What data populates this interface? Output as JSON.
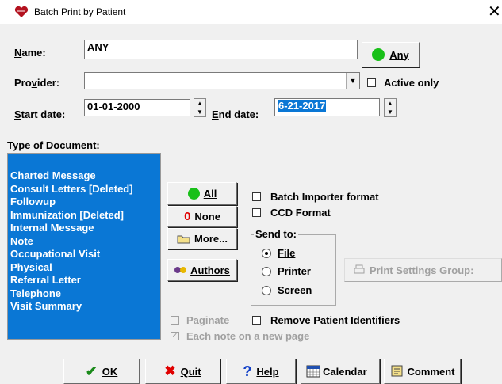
{
  "window": {
    "title": "Batch Print by Patient",
    "close_glyph": "✕"
  },
  "name_row": {
    "label": "Name:",
    "value": "ANY",
    "any_button": "Any"
  },
  "provider_row": {
    "label": "Provider:",
    "value": "",
    "active_only": "Active only",
    "active_only_checked": false
  },
  "dates": {
    "start_label": "Start date:",
    "start_value": "01-01-2000",
    "end_label": "End date:",
    "end_value": "6-21-2017"
  },
  "documents": {
    "label": "Type of Document:",
    "items": [
      "Charted Message",
      "Consult Letters [Deleted]",
      "Followup",
      "Immunization [Deleted]",
      "Internal Message",
      "Note",
      "Occupational Visit",
      "Physical",
      "Referral Letter",
      "Telephone",
      "Visit Summary"
    ],
    "selection_color": "#0a77d5"
  },
  "buttons": {
    "all": "All",
    "none": "None",
    "more": "More...",
    "authors": "Authors",
    "print_settings": "Print Settings Group:"
  },
  "options": {
    "batch_importer": "Batch Importer format",
    "ccd": "CCD Format",
    "paginate": "Paginate",
    "remove_ids": "Remove Patient Identifiers",
    "each_note": "Each note on a new page"
  },
  "send_to": {
    "legend": "Send to:",
    "file": "File",
    "printer": "Printer",
    "screen": "Screen",
    "selected": "File"
  },
  "footer": {
    "ok": "OK",
    "quit": "Quit",
    "help": "Help",
    "calendar": "Calendar",
    "comment": "Comment"
  },
  "colors": {
    "green": "#19c019",
    "red": "#e00000",
    "title_bg": "#ffffff"
  }
}
